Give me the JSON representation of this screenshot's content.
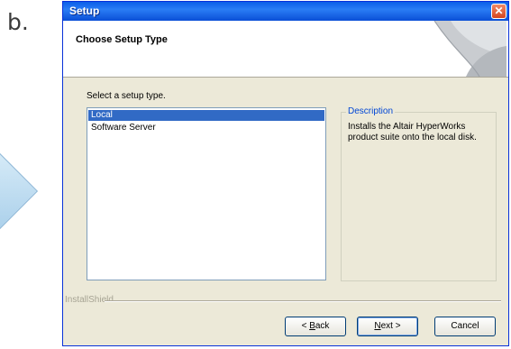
{
  "slide": {
    "step_label": "b."
  },
  "window": {
    "title": "Setup",
    "close_glyph": "✕",
    "header_title": "Choose Setup Type",
    "prompt": "Select a setup type.",
    "setup_types": [
      {
        "label": "Local",
        "selected": true
      },
      {
        "label": "Software Server",
        "selected": false
      }
    ],
    "description": {
      "legend": "Description",
      "text": "Installs the Altair HyperWorks product suite onto the local disk."
    },
    "brand": "InstallShield",
    "buttons": {
      "back": {
        "pre": "< ",
        "accel": "B",
        "post": "ack"
      },
      "next": {
        "pre": "",
        "accel": "N",
        "post": "ext >"
      },
      "cancel": {
        "label": "Cancel"
      }
    }
  },
  "colors": {
    "titlebar": "#0a5ee8",
    "selection": "#316ac5",
    "dialog_bg": "#ece9d8",
    "legend_text": "#0046d5"
  },
  "icons": [
    "close-icon",
    "header-art-icon",
    "next-arrow-icon"
  ]
}
